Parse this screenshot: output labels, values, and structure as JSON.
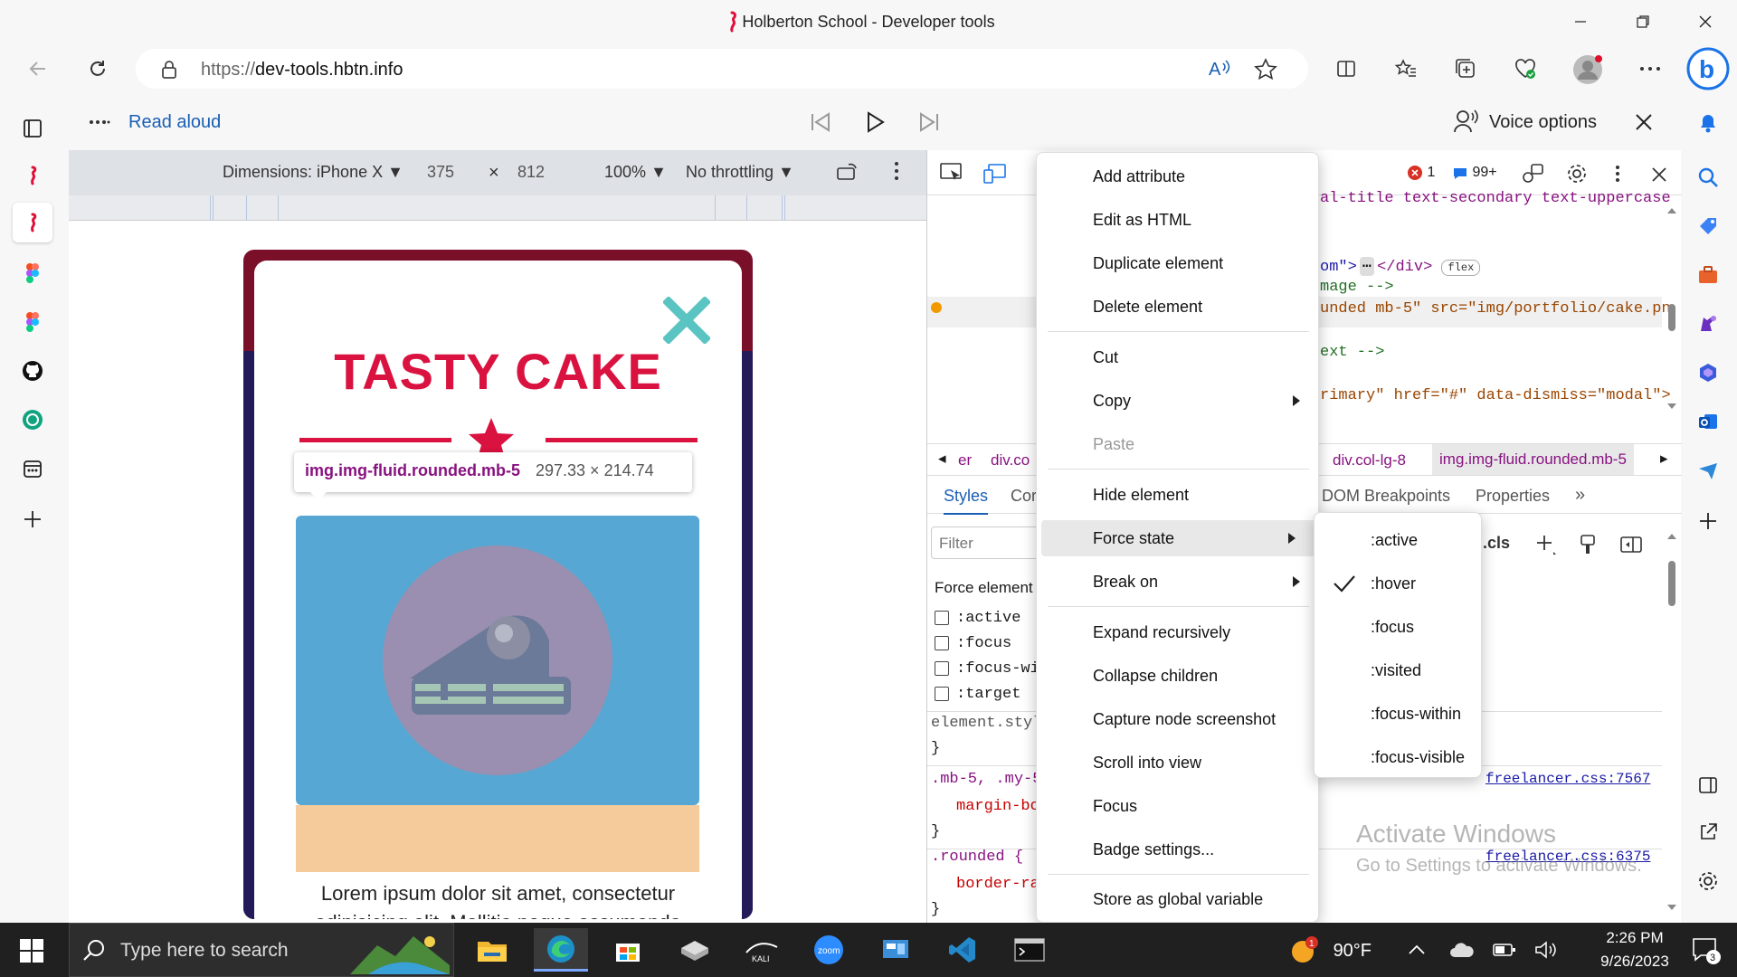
{
  "window": {
    "title": "Holberton School - Developer tools"
  },
  "addressbar": {
    "url_prefix": "https://",
    "url_host": "dev-tools.hbtn.info"
  },
  "readbar": {
    "read_aloud": "Read aloud",
    "voice_options": "Voice options"
  },
  "device_toolbar": {
    "dimensions": "Dimensions: iPhone X",
    "width": "375",
    "times": "×",
    "height": "812",
    "zoom": "100%",
    "throttling": "No throttling"
  },
  "page": {
    "title": "TASTY CAKE",
    "tooltip_selector": "img.img-fluid.rounded.mb-5",
    "tooltip_size": "297.33 × 214.74",
    "lorem_line1": "Lorem ipsum dolor sit amet, consectetur",
    "lorem_line2": "adipisicing elit. Mollitia neque assumenda"
  },
  "devtools": {
    "errors": "1",
    "messages": "99+",
    "code_lines": [
      "al-title text-secondary text-uppercase",
      "om\">",
      "</div>",
      "flex",
      "mage -->",
      "unded mb-5\" src=\"img/portfolio/cake.pn",
      "ext -->",
      "rimary\" href=\"#\" data-dismiss=\"modal\">"
    ],
    "breadcrumb": {
      "left1": "er",
      "left2": "div.co",
      "item1": "div.col-lg-8",
      "item2": "img.img-fluid.rounded.mb-5"
    },
    "tabs": {
      "styles": "Styles",
      "computed": "Cor",
      "dom_breakpoints": "DOM Breakpoints",
      "properties": "Properties"
    },
    "filter_placeholder": "Filter",
    "cls": ".cls",
    "force_element_state": "Force element",
    "states": [
      ":active",
      ":focus",
      ":focus-wi",
      ":target"
    ],
    "rules": {
      "element_style": "element.styl",
      "close_brace": "}",
      "mb5_selector": ".mb-5, .my-5",
      "mb5_prop": "margin-bo",
      "rounded_selector": ".rounded {",
      "rounded_prop": "border-ra",
      "source1": "freelancer.css:7567",
      "source2": "freelancer.css:6375"
    },
    "activate_title": "Activate Windows",
    "activate_sub": "Go to Settings to activate Windows."
  },
  "context_menu": {
    "items": [
      "Add attribute",
      "Edit as HTML",
      "Duplicate element",
      "Delete element",
      "Cut",
      "Copy",
      "Paste",
      "Hide element",
      "Force state",
      "Break on",
      "Expand recursively",
      "Collapse children",
      "Capture node screenshot",
      "Scroll into view",
      "Focus",
      "Badge settings...",
      "Store as global variable"
    ]
  },
  "force_state_submenu": {
    "items": [
      ":active",
      ":hover",
      ":focus",
      ":visited",
      ":focus-within",
      ":focus-visible"
    ],
    "checked": ":hover"
  },
  "taskbar": {
    "search_placeholder": "Type here to search",
    "temperature": "90°F",
    "time": "2:26 PM",
    "date": "9/26/2023",
    "notification_count": "3",
    "weather_badge": "1"
  },
  "colors": {
    "accent_red": "#d9123f",
    "teal": "#5ac4c2",
    "image_blue": "#56a7d3",
    "peach": "#f6cb9b",
    "tooltip_purple": "#881280",
    "link_blue": "#1a5fb4"
  }
}
